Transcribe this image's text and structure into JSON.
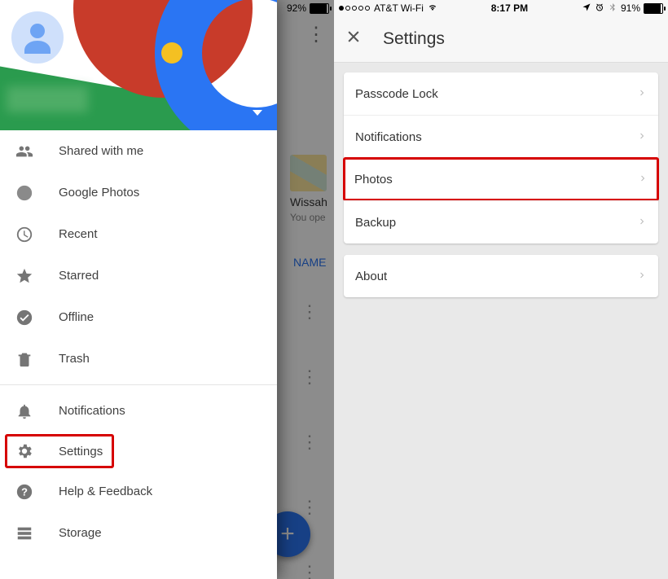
{
  "left": {
    "status": {
      "battery_pct": "92%"
    },
    "file": {
      "title": "Wissah",
      "sub": "You ope"
    },
    "sort_label": "NAME",
    "fab_label": "+",
    "menu": [
      {
        "icon": "people-icon",
        "label": "Shared with me"
      },
      {
        "icon": "photos-icon",
        "label": "Google Photos"
      },
      {
        "icon": "recent-icon",
        "label": "Recent"
      },
      {
        "icon": "star-icon",
        "label": "Starred"
      },
      {
        "icon": "offline-icon",
        "label": "Offline"
      },
      {
        "icon": "trash-icon",
        "label": "Trash"
      }
    ],
    "menu2": [
      {
        "icon": "bell-icon",
        "label": "Notifications"
      },
      {
        "icon": "gear-icon",
        "label": "Settings",
        "highlight": true
      },
      {
        "icon": "help-icon",
        "label": "Help & Feedback"
      },
      {
        "icon": "storage-icon",
        "label": "Storage"
      }
    ]
  },
  "right": {
    "status": {
      "carrier": "AT&T Wi-Fi",
      "time": "8:17 PM",
      "battery_pct": "91%"
    },
    "title": "Settings",
    "group1": [
      {
        "label": "Passcode Lock"
      },
      {
        "label": "Notifications"
      },
      {
        "label": "Photos",
        "highlight": true
      },
      {
        "label": "Backup"
      }
    ],
    "group2": [
      {
        "label": "About"
      }
    ]
  }
}
